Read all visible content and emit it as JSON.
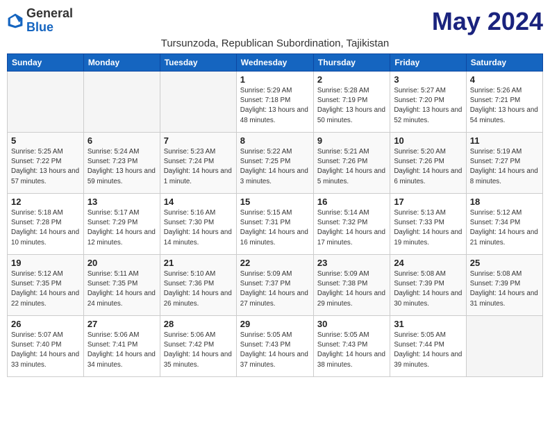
{
  "header": {
    "logo_line1": "General",
    "logo_line2": "Blue",
    "month_title": "May 2024",
    "subtitle": "Tursunzoda, Republican Subordination, Tajikistan"
  },
  "weekdays": [
    "Sunday",
    "Monday",
    "Tuesday",
    "Wednesday",
    "Thursday",
    "Friday",
    "Saturday"
  ],
  "weeks": [
    [
      {
        "day": "",
        "sunrise": "",
        "sunset": "",
        "daylight": ""
      },
      {
        "day": "",
        "sunrise": "",
        "sunset": "",
        "daylight": ""
      },
      {
        "day": "",
        "sunrise": "",
        "sunset": "",
        "daylight": ""
      },
      {
        "day": "1",
        "sunrise": "Sunrise: 5:29 AM",
        "sunset": "Sunset: 7:18 PM",
        "daylight": "Daylight: 13 hours and 48 minutes."
      },
      {
        "day": "2",
        "sunrise": "Sunrise: 5:28 AM",
        "sunset": "Sunset: 7:19 PM",
        "daylight": "Daylight: 13 hours and 50 minutes."
      },
      {
        "day": "3",
        "sunrise": "Sunrise: 5:27 AM",
        "sunset": "Sunset: 7:20 PM",
        "daylight": "Daylight: 13 hours and 52 minutes."
      },
      {
        "day": "4",
        "sunrise": "Sunrise: 5:26 AM",
        "sunset": "Sunset: 7:21 PM",
        "daylight": "Daylight: 13 hours and 54 minutes."
      }
    ],
    [
      {
        "day": "5",
        "sunrise": "Sunrise: 5:25 AM",
        "sunset": "Sunset: 7:22 PM",
        "daylight": "Daylight: 13 hours and 57 minutes."
      },
      {
        "day": "6",
        "sunrise": "Sunrise: 5:24 AM",
        "sunset": "Sunset: 7:23 PM",
        "daylight": "Daylight: 13 hours and 59 minutes."
      },
      {
        "day": "7",
        "sunrise": "Sunrise: 5:23 AM",
        "sunset": "Sunset: 7:24 PM",
        "daylight": "Daylight: 14 hours and 1 minute."
      },
      {
        "day": "8",
        "sunrise": "Sunrise: 5:22 AM",
        "sunset": "Sunset: 7:25 PM",
        "daylight": "Daylight: 14 hours and 3 minutes."
      },
      {
        "day": "9",
        "sunrise": "Sunrise: 5:21 AM",
        "sunset": "Sunset: 7:26 PM",
        "daylight": "Daylight: 14 hours and 5 minutes."
      },
      {
        "day": "10",
        "sunrise": "Sunrise: 5:20 AM",
        "sunset": "Sunset: 7:26 PM",
        "daylight": "Daylight: 14 hours and 6 minutes."
      },
      {
        "day": "11",
        "sunrise": "Sunrise: 5:19 AM",
        "sunset": "Sunset: 7:27 PM",
        "daylight": "Daylight: 14 hours and 8 minutes."
      }
    ],
    [
      {
        "day": "12",
        "sunrise": "Sunrise: 5:18 AM",
        "sunset": "Sunset: 7:28 PM",
        "daylight": "Daylight: 14 hours and 10 minutes."
      },
      {
        "day": "13",
        "sunrise": "Sunrise: 5:17 AM",
        "sunset": "Sunset: 7:29 PM",
        "daylight": "Daylight: 14 hours and 12 minutes."
      },
      {
        "day": "14",
        "sunrise": "Sunrise: 5:16 AM",
        "sunset": "Sunset: 7:30 PM",
        "daylight": "Daylight: 14 hours and 14 minutes."
      },
      {
        "day": "15",
        "sunrise": "Sunrise: 5:15 AM",
        "sunset": "Sunset: 7:31 PM",
        "daylight": "Daylight: 14 hours and 16 minutes."
      },
      {
        "day": "16",
        "sunrise": "Sunrise: 5:14 AM",
        "sunset": "Sunset: 7:32 PM",
        "daylight": "Daylight: 14 hours and 17 minutes."
      },
      {
        "day": "17",
        "sunrise": "Sunrise: 5:13 AM",
        "sunset": "Sunset: 7:33 PM",
        "daylight": "Daylight: 14 hours and 19 minutes."
      },
      {
        "day": "18",
        "sunrise": "Sunrise: 5:12 AM",
        "sunset": "Sunset: 7:34 PM",
        "daylight": "Daylight: 14 hours and 21 minutes."
      }
    ],
    [
      {
        "day": "19",
        "sunrise": "Sunrise: 5:12 AM",
        "sunset": "Sunset: 7:35 PM",
        "daylight": "Daylight: 14 hours and 22 minutes."
      },
      {
        "day": "20",
        "sunrise": "Sunrise: 5:11 AM",
        "sunset": "Sunset: 7:35 PM",
        "daylight": "Daylight: 14 hours and 24 minutes."
      },
      {
        "day": "21",
        "sunrise": "Sunrise: 5:10 AM",
        "sunset": "Sunset: 7:36 PM",
        "daylight": "Daylight: 14 hours and 26 minutes."
      },
      {
        "day": "22",
        "sunrise": "Sunrise: 5:09 AM",
        "sunset": "Sunset: 7:37 PM",
        "daylight": "Daylight: 14 hours and 27 minutes."
      },
      {
        "day": "23",
        "sunrise": "Sunrise: 5:09 AM",
        "sunset": "Sunset: 7:38 PM",
        "daylight": "Daylight: 14 hours and 29 minutes."
      },
      {
        "day": "24",
        "sunrise": "Sunrise: 5:08 AM",
        "sunset": "Sunset: 7:39 PM",
        "daylight": "Daylight: 14 hours and 30 minutes."
      },
      {
        "day": "25",
        "sunrise": "Sunrise: 5:08 AM",
        "sunset": "Sunset: 7:39 PM",
        "daylight": "Daylight: 14 hours and 31 minutes."
      }
    ],
    [
      {
        "day": "26",
        "sunrise": "Sunrise: 5:07 AM",
        "sunset": "Sunset: 7:40 PM",
        "daylight": "Daylight: 14 hours and 33 minutes."
      },
      {
        "day": "27",
        "sunrise": "Sunrise: 5:06 AM",
        "sunset": "Sunset: 7:41 PM",
        "daylight": "Daylight: 14 hours and 34 minutes."
      },
      {
        "day": "28",
        "sunrise": "Sunrise: 5:06 AM",
        "sunset": "Sunset: 7:42 PM",
        "daylight": "Daylight: 14 hours and 35 minutes."
      },
      {
        "day": "29",
        "sunrise": "Sunrise: 5:05 AM",
        "sunset": "Sunset: 7:43 PM",
        "daylight": "Daylight: 14 hours and 37 minutes."
      },
      {
        "day": "30",
        "sunrise": "Sunrise: 5:05 AM",
        "sunset": "Sunset: 7:43 PM",
        "daylight": "Daylight: 14 hours and 38 minutes."
      },
      {
        "day": "31",
        "sunrise": "Sunrise: 5:05 AM",
        "sunset": "Sunset: 7:44 PM",
        "daylight": "Daylight: 14 hours and 39 minutes."
      },
      {
        "day": "",
        "sunrise": "",
        "sunset": "",
        "daylight": ""
      }
    ]
  ]
}
